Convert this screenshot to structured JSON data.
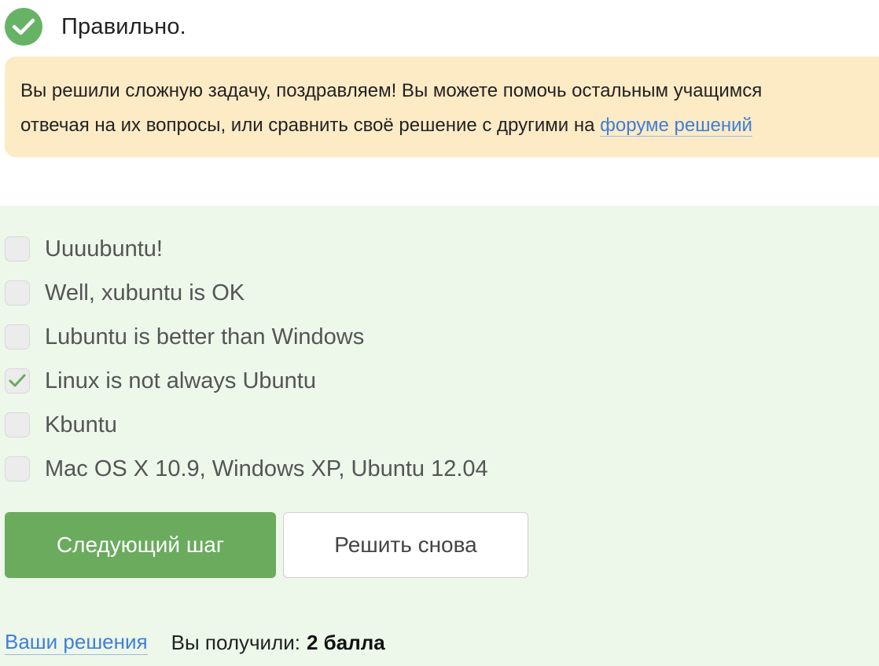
{
  "status": {
    "text": "Правильно.",
    "icon": "check-circle-icon",
    "color": "#66b366"
  },
  "notice": {
    "line1": "Вы решили сложную задачу, поздравляем! Вы можете помочь остальным учащимся",
    "line2_prefix": "отвечая на их вопросы, или сравнить своё решение с другими на ",
    "forum_link": "форуме решений",
    "background": "#fdebc6"
  },
  "options": [
    {
      "label": "Uuuubuntu!",
      "checked": false
    },
    {
      "label": "Well, xubuntu is OK",
      "checked": false
    },
    {
      "label": "Lubuntu is better than Windows",
      "checked": false
    },
    {
      "label": "Linux is not always Ubuntu",
      "checked": true
    },
    {
      "label": "Kbuntu",
      "checked": false
    },
    {
      "label": "Mac OS X 10.9, Windows XP, Ubuntu 12.04",
      "checked": false
    }
  ],
  "buttons": {
    "next": "Следующий шаг",
    "retry": "Решить снова"
  },
  "footer": {
    "solutions_link": "Ваши решения",
    "score_label": "Вы получили:",
    "score_value": "2 балла"
  },
  "colors": {
    "accent_green": "#6aab5d",
    "quiz_background": "#edf7ea",
    "link_blue": "#3f7fd8"
  }
}
